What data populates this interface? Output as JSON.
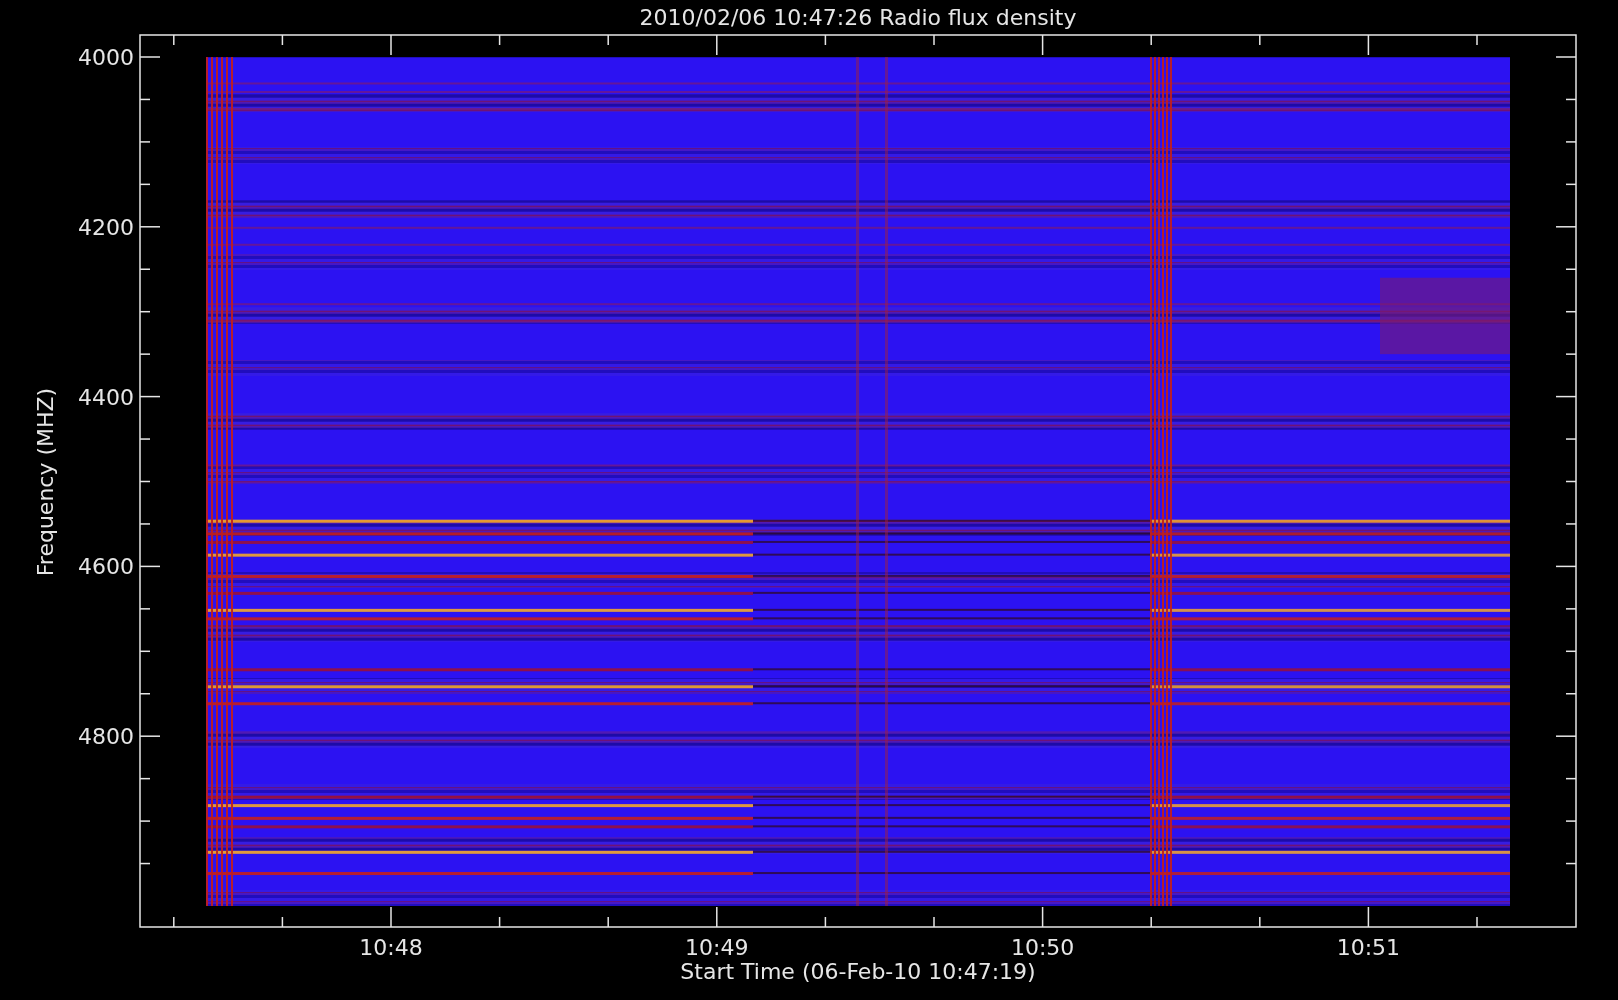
{
  "plot": {
    "title": "2010/02/06 10:47:26 Radio flux density",
    "y_axis": {
      "label": "Frequency (MHZ)",
      "ticks": [
        "4000",
        "4200",
        "4400",
        "4600",
        "4800"
      ]
    },
    "x_axis": {
      "label": "Start Time (06-Feb-10 10:47:19)",
      "ticks": [
        "10:48",
        "10:49",
        "10:50",
        "10:51"
      ]
    }
  }
}
